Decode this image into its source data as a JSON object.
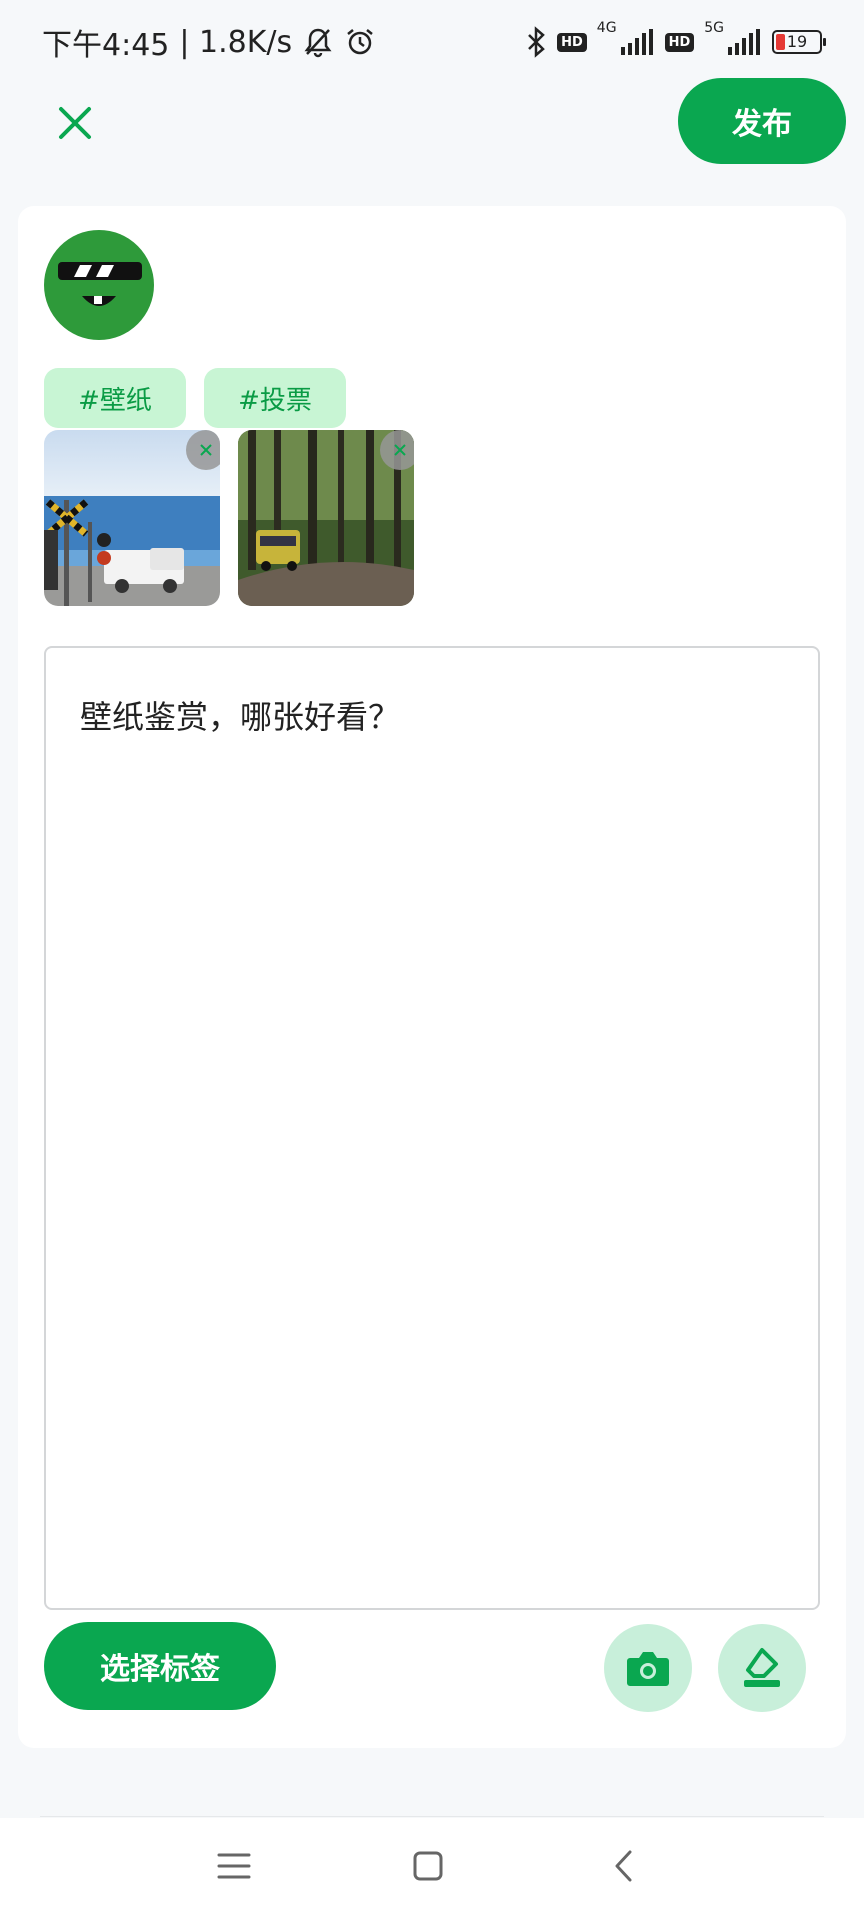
{
  "status_bar": {
    "time": "下午4:45",
    "speed": "| 1.8K/s",
    "hd_badge": "HD",
    "net_4g": "4G",
    "net_5g": "5G",
    "battery": "19"
  },
  "header": {
    "close_icon": "close-icon",
    "publish_label": "发布"
  },
  "post": {
    "tags": [
      "#壁纸",
      "#投票"
    ],
    "images": [
      {
        "name": "beach-railroad-crossing-image"
      },
      {
        "name": "forest-road-bus-image"
      }
    ],
    "text": "壁纸鉴赏，哪张好看？"
  },
  "actions": {
    "select_tag_label": "选择标签",
    "camera_icon": "camera-icon",
    "erase_icon": "eraser-icon"
  },
  "colors": {
    "accent": "#0aa750",
    "tag_bg": "#c8f5d4",
    "tag_text": "#0a9b45",
    "round_btn_bg": "#c8efda"
  },
  "nav": {
    "menu_icon": "menu-icon",
    "home_icon": "home-icon",
    "back_icon": "back-icon"
  }
}
